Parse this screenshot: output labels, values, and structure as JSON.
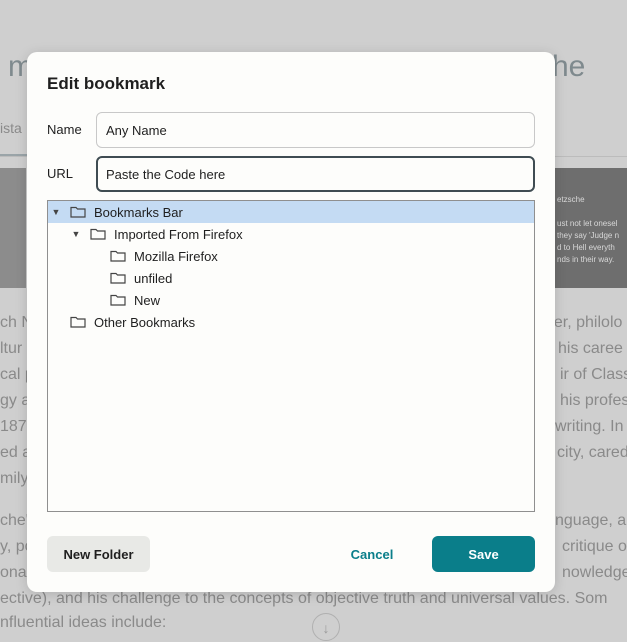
{
  "background": {
    "title_left": "m",
    "title_right": "he",
    "tab_label": "ista",
    "image_right_text": "etzsche\n\nust not let onesel\nthey say 'Judge n\nd to Hell everyth\nnds in their way.",
    "lines": [
      {
        "text": "ch N",
        "right": "her, philolo"
      },
      {
        "text": "ltur",
        "right": "his caree"
      },
      {
        "text": "cal p",
        "right": "ir of Class"
      },
      {
        "text": "gy a",
        "right": "his profes"
      },
      {
        "text": "187",
        "right": "writing. In"
      },
      {
        "text": "ed a",
        "right": "city, cared"
      },
      {
        "text": "mily",
        "right": ""
      }
    ],
    "para2": [
      {
        "text": "che's",
        "right": "nguage, an"
      },
      {
        "text": "y, po",
        "right": "critique o"
      },
      {
        "text": "onal",
        "right": "nowledge"
      },
      {
        "text": "ective), and his challenge to the concepts of objective truth and universal values. Som",
        "right": ""
      },
      {
        "text": "nfluential ideas include:",
        "right": ""
      }
    ],
    "scroll_icon": "↓"
  },
  "dialog": {
    "title": "Edit bookmark",
    "name_label": "Name",
    "name_value": "Any Name",
    "url_label": "URL",
    "url_value": "Paste the Code here",
    "tree": [
      {
        "label": "Bookmarks Bar",
        "level": 0,
        "expanded": true,
        "selected": true
      },
      {
        "label": "Imported From Firefox",
        "level": 1,
        "expanded": true,
        "selected": false
      },
      {
        "label": "Mozilla Firefox",
        "level": 2,
        "expanded": false,
        "selected": false
      },
      {
        "label": "unfiled",
        "level": 2,
        "expanded": false,
        "selected": false
      },
      {
        "label": "New",
        "level": 2,
        "expanded": false,
        "selected": false
      },
      {
        "label": "Other Bookmarks",
        "level": 0,
        "expanded": false,
        "selected": false
      }
    ],
    "new_folder_label": "New Folder",
    "cancel_label": "Cancel",
    "save_label": "Save"
  },
  "colors": {
    "accent": "#0a7e8a",
    "selection": "#c4dbf3"
  }
}
